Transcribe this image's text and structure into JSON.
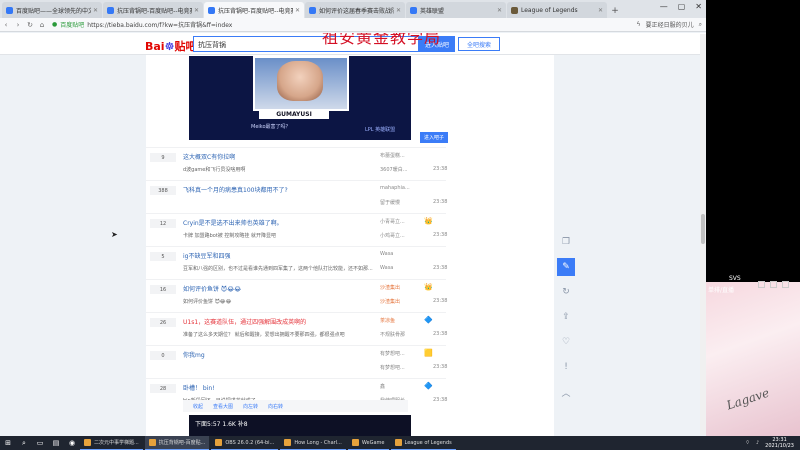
{
  "browser": {
    "tabs": [
      {
        "label": "百度贴吧——全球领先的中文社区",
        "active": false
      },
      {
        "label": "抗压背锅吧-百度贴吧--电竞赛好者和...",
        "active": false
      },
      {
        "label": "抗压背锅吧-百度贴吧--电竞赛好者和...",
        "active": true
      },
      {
        "label": "如何评价这届春季赛击败战队...",
        "active": false
      },
      {
        "label": "英雄联盟",
        "active": false
      },
      {
        "label": "League of Legends",
        "active": false
      }
    ],
    "address": {
      "site_label": "百度贴吧",
      "url": "https://tieba.baidu.com/f?kw=抗压背锅&ff=index"
    },
    "right_hint": "要正经日服的贝儿",
    "window_controls": [
      "—",
      "▢",
      "✕"
    ]
  },
  "tieba_header": {
    "logo_text": "Bai",
    "logo_text2": "贴吧",
    "search_value": "抗压背锅",
    "enter_button": "进入贴吧",
    "search_all_button": "全吧搜索"
  },
  "watermark": "祖安黄金教学局",
  "video": {
    "player_name": "GUMAYUSI",
    "caption": "Meiko最害了吗？",
    "brand": "LPL 英雄联盟"
  },
  "join_small_button": "进入吧子",
  "threads": [
    {
      "count": "9",
      "title": "这大概双C有你拉啊",
      "excerpt": "d波game和飞行员没啥用啊",
      "author": "布蕾蛋糕...",
      "replier": "3607暖白...",
      "time": "23:38",
      "badge": ""
    },
    {
      "count": "388",
      "title": "飞科真一个月的病患真100块都用不了?",
      "excerpt": "",
      "author": "mahaphia...",
      "replier": "留于缓慢",
      "time": "23:38",
      "badge": ""
    },
    {
      "count": "12",
      "title": "Cryin是不是选不出来帅也英雄了啊。",
      "excerpt": "卡牌 加盟路bot被 控制攻略挂 就开降显吧",
      "author": "小青哥立...",
      "replier": "小鸡哥立...",
      "time": "23:38",
      "badge": "👑"
    },
    {
      "count": "5",
      "title": "ig不缺豆军和四强",
      "excerpt": "豆军和八强的区别，也不过是看谁先通到四军集了，这两个他队打比较能，还不如那...",
      "author": "Wasa",
      "replier": "Wasa",
      "time": "23:38",
      "badge": ""
    },
    {
      "count": "16",
      "title": "如何评价鱼饼 😈😂😂",
      "excerpt": "如何评价鱼饼 😈😂😂",
      "author": "沙渣集出",
      "replier": "沙渣集出",
      "time": "23:38",
      "badge": "👑"
    },
    {
      "count": "26",
      "title": "U1s1，这赛道队伍，通过四强解围改成英啊的",
      "excerpt": "准备了这么多天期位？ 就后和醒接，爱想出拥醒不要那四强，都很强点吧",
      "author": "茶凉鱼",
      "replier": "不规肤骨那",
      "time": "23:38",
      "badge": "🔷"
    },
    {
      "count": "0",
      "title": "你我mg",
      "excerpt": "",
      "author": "有梦想吧...",
      "replier": "有梦想吧...",
      "time": "23:38",
      "badge": "🟨"
    },
    {
      "count": "28",
      "title": "卧槽！ bin!",
      "excerpt": "bin新段回还，日说把求花就成了",
      "author": "鑫",
      "replier": "我使理服长",
      "time": "23:38",
      "badge": "🔷"
    }
  ],
  "post_toolbar": [
    "收起",
    "查看大图",
    "向左转",
    "向右转"
  ],
  "post_image_text": "下面5:57 1.6K 补8",
  "right_rail_icons": [
    "bookmark-icon",
    "edit-icon",
    "refresh-icon",
    "share-icon",
    "heart-icon",
    "report-icon",
    "back-to-top-icon"
  ],
  "side_panel": {
    "overlay_title": "SVS",
    "overlay_text": "单排/直播",
    "signature": "Lagave"
  },
  "taskbar": {
    "apps": [
      {
        "label": "二次元中事学梯题...",
        "active": false
      },
      {
        "label": "抗压背锅吧-百度贴...",
        "active": true
      },
      {
        "label": "OBS 26.0.2 (64-bi...",
        "active": false
      },
      {
        "label": "How Long - Charl...",
        "active": false
      },
      {
        "label": "WeGame",
        "active": false
      },
      {
        "label": "League of Legends",
        "active": false
      }
    ],
    "time": "23:31",
    "date": "2021/10/23"
  }
}
